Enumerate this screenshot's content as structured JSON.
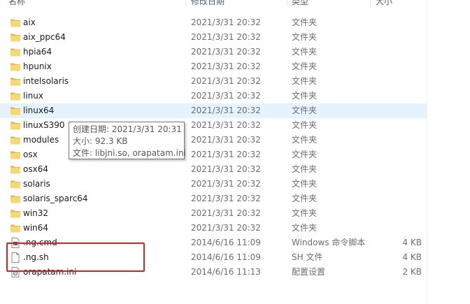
{
  "header": {
    "name": "名称",
    "date": "修改日期",
    "type": "类型",
    "size": "大小"
  },
  "files": [
    {
      "name": "aix",
      "date": "2021/3/31 20:32",
      "type": "文件夹",
      "size": "",
      "icon": "folder-icon"
    },
    {
      "name": "aix_ppc64",
      "date": "2021/3/31 20:32",
      "type": "文件夹",
      "size": "",
      "icon": "folder-icon"
    },
    {
      "name": "hpia64",
      "date": "2021/3/31 20:32",
      "type": "文件夹",
      "size": "",
      "icon": "folder-icon"
    },
    {
      "name": "hpunix",
      "date": "2021/3/31 20:32",
      "type": "文件夹",
      "size": "",
      "icon": "folder-icon"
    },
    {
      "name": "intelsolaris",
      "date": "2021/3/31 20:32",
      "type": "文件夹",
      "size": "",
      "icon": "folder-icon"
    },
    {
      "name": "linux",
      "date": "2021/3/31 20:32",
      "type": "文件夹",
      "size": "",
      "icon": "folder-icon"
    },
    {
      "name": "linux64",
      "date": "2021/3/31 20:32",
      "type": "文件夹",
      "size": "",
      "icon": "folder-icon"
    },
    {
      "name": "linuxS390",
      "date": "2021/3/31 20:32",
      "type": "文件夹",
      "size": "",
      "icon": "folder-icon"
    },
    {
      "name": "modules",
      "date": "2021/3/31 20:32",
      "type": "文件夹",
      "size": "",
      "icon": "folder-icon"
    },
    {
      "name": "osx",
      "date": "2021/3/31 20:32",
      "type": "文件夹",
      "size": "",
      "icon": "folder-icon"
    },
    {
      "name": "osx64",
      "date": "2021/3/31 20:32",
      "type": "文件夹",
      "size": "",
      "icon": "folder-icon"
    },
    {
      "name": "solaris",
      "date": "2021/3/31 20:32",
      "type": "文件夹",
      "size": "",
      "icon": "folder-icon"
    },
    {
      "name": "solaris_sparc64",
      "date": "2021/3/31 20:32",
      "type": "文件夹",
      "size": "",
      "icon": "folder-icon"
    },
    {
      "name": "win32",
      "date": "2021/3/31 20:32",
      "type": "文件夹",
      "size": "",
      "icon": "folder-icon"
    },
    {
      "name": "win64",
      "date": "2021/3/31 20:32",
      "type": "文件夹",
      "size": "",
      "icon": "folder-icon"
    },
    {
      "name": ".ng.cmd",
      "date": "2014/6/16 11:09",
      "type": "Windows 命令脚本",
      "size": "4 KB",
      "icon": "cmd-file-icon"
    },
    {
      "name": ".ng.sh",
      "date": "2014/6/16 11:09",
      "type": "SH 文件",
      "size": "4 KB",
      "icon": "file-icon"
    },
    {
      "name": "orapatam.ini",
      "date": "2014/6/16 11:13",
      "type": "配置设置",
      "size": "2 KB",
      "icon": "ini-file-icon"
    }
  ],
  "tooltip": {
    "created": "创建日期: 2021/3/31 20:31",
    "size": "大小: 92.3 KB",
    "files": "文件: libjni.so, orapatam.ini"
  },
  "colors": {
    "folder": "#f8d775",
    "hover_row": "#e5f3ff",
    "highlight_border": "#e0201b"
  }
}
